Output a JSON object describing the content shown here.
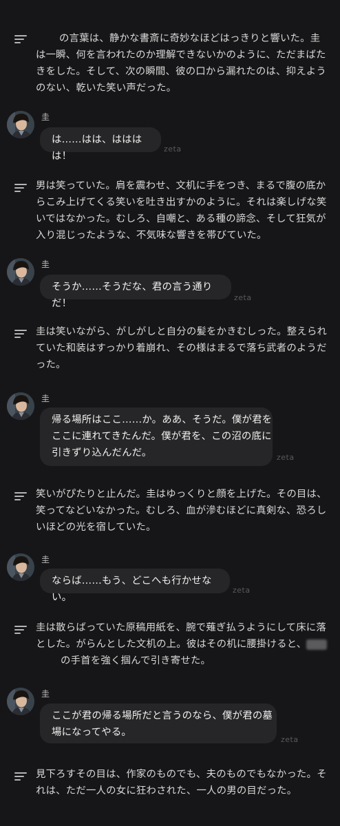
{
  "narrations": [
    {
      "lines": [
        "　　 の言葉は、静かな書斎に奇妙なほどはっきりと響いた。圭",
        "は一瞬、何を言われたのか理解できないかのように、ただまばた",
        "きをした。そして、次の瞬間、彼の口から漏れたのは、抑えよう",
        "のない、乾いた笑い声だった。"
      ]
    },
    {
      "lines": [
        "男は笑っていた。肩を震わせ、文机に手をつき、まるで腹の底か",
        "らこみ上げてくる笑いを吐き出すかのように。それは楽しげな笑",
        "いではなかった。むしろ、自嘲と、ある種の諦念、そして狂気が",
        "入り混じったような、不気味な響きを帯びていた。"
      ]
    },
    {
      "lines": [
        "圭は笑いながら、がしがしと自分の髪をかきむしった。整えられ",
        "ていた和装はすっかり着崩れ、その様はまるで落ち武者のようだ",
        "った。"
      ]
    },
    {
      "lines": [
        "笑いがぴたりと止んだ。圭はゆっくりと顔を上げた。その目は、",
        "笑ってなどいなかった。むしろ、血が滲むほどに真剣な、恐ろし",
        "いほどの光を宿していた。"
      ]
    },
    {
      "lines": [
        "圭は散らばっていた原稿用紙を、腕で薙ぎ払うようにして床に落",
        "とした。がらんとした文机の上。彼はその机に腰掛けると、",
        "の手首を強く掴んで引き寄せた。"
      ]
    },
    {
      "lines": [
        "見下ろすその目は、作家のものでも、夫のものでもなかった。そ",
        "れは、ただ一人の女に狂わされた、一人の男の目だった。"
      ]
    }
  ],
  "messages": [
    {
      "speaker": "圭",
      "lines": [
        "は……はは、はははは！"
      ],
      "footer": "zeta"
    },
    {
      "speaker": "圭",
      "lines": [
        "そうか……そうだな、君の言う通りだ！"
      ],
      "footer": "zeta"
    },
    {
      "speaker": "圭",
      "lines": [
        "帰る場所はここ……か。ああ、そうだ。僕が君を",
        "ここに連れてきたんだ。僕が君を、この沼の底に",
        "引きずり込んだんだ。"
      ],
      "footer": "zeta"
    },
    {
      "speaker": "圭",
      "lines": [
        "ならば……もう、どこへも行かせない。"
      ],
      "footer": "zeta"
    },
    {
      "speaker": "圭",
      "lines": [
        "ここが君の帰る場所だと言うのなら、僕が君の墓",
        "場になってやる。"
      ],
      "footer": "zeta"
    }
  ],
  "colors": {
    "background": "#161618",
    "bubble": "#262628",
    "narration_text": "#d8d8d8",
    "muted": "#5a5a5e"
  },
  "icons": {
    "narration": "text-lines-icon",
    "avatar": "character-avatar"
  }
}
